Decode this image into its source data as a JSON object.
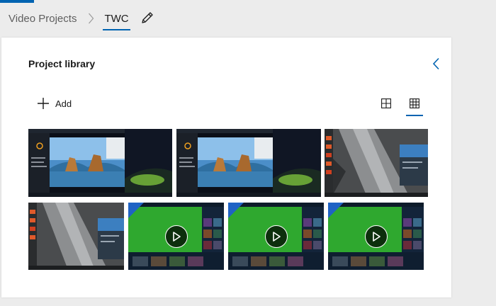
{
  "breadcrumb": {
    "parent_label": "Video Projects",
    "current_label": "TWC"
  },
  "library": {
    "title": "Project library",
    "add_label": "Add"
  },
  "colors": {
    "accent": "#0063b1",
    "xbox_green": "#2fa82f",
    "corner_blue": "#1f63c4"
  },
  "icons": {
    "separator": "chevron-right-icon",
    "edit": "pencil-icon",
    "collapse": "chevron-left-icon",
    "add": "plus-icon",
    "large_view": "large-grid-icon",
    "small_view": "small-grid-icon",
    "play": "play-icon"
  },
  "media_items": [
    {
      "kind": "desktop-screenshot",
      "subject": "windows-10-desktop"
    },
    {
      "kind": "desktop-screenshot",
      "subject": "windows-10-desktop"
    },
    {
      "kind": "desktop-screenshot",
      "subject": "rock-wallpaper-desktop"
    },
    {
      "kind": "desktop-screenshot",
      "subject": "rock-wallpaper-desktop"
    },
    {
      "kind": "video",
      "subject": "xbox-app"
    },
    {
      "kind": "video",
      "subject": "xbox-app"
    },
    {
      "kind": "video",
      "subject": "xbox-app"
    }
  ],
  "view_mode": "small-thumbnails"
}
